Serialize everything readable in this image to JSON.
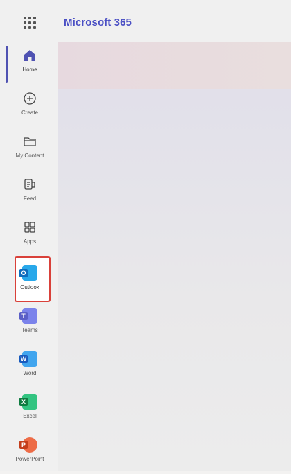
{
  "header": {
    "app_title": "Microsoft 365"
  },
  "nav": {
    "items": [
      {
        "label": "Home",
        "icon": "home-icon"
      },
      {
        "label": "Create",
        "icon": "plus-circle-icon"
      },
      {
        "label": "My Content",
        "icon": "folder-icon"
      },
      {
        "label": "Feed",
        "icon": "feed-icon"
      },
      {
        "label": "Apps",
        "icon": "apps-grid-icon"
      },
      {
        "label": "Outlook",
        "icon": "outlook-icon"
      },
      {
        "label": "Teams",
        "icon": "teams-icon"
      },
      {
        "label": "Word",
        "icon": "word-icon"
      },
      {
        "label": "Excel",
        "icon": "excel-icon"
      },
      {
        "label": "PowerPoint",
        "icon": "powerpoint-icon"
      }
    ]
  },
  "colors": {
    "accent": "#4f52b2",
    "title": "#4a4fc4",
    "highlight": "#d9413a",
    "outlook": "#0f6cbd",
    "teams": "#5b5fc7",
    "word": "#185abd",
    "excel": "#107c41",
    "powerpoint": "#c43e1c"
  }
}
